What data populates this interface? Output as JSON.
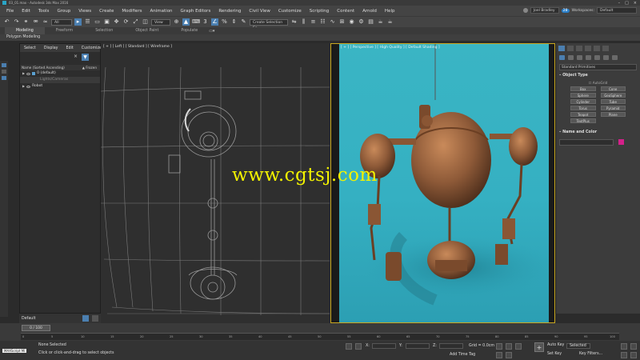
{
  "titlebar": {
    "title": "03_01.max - Autodesk 3ds Max 2016"
  },
  "menus": [
    "File",
    "Edit",
    "Tools",
    "Group",
    "Views",
    "Create",
    "Modifiers",
    "Animation",
    "Graph Editors",
    "Rendering",
    "Civil View",
    "Customize",
    "Scripting",
    "Content",
    "Arnold",
    "Help"
  ],
  "user": {
    "name": "Joel Bradley",
    "badge": "28"
  },
  "workspace": {
    "label": "Workspaces:",
    "value": "Default"
  },
  "toolbar": {
    "filter": "All",
    "view": "View",
    "selection_set": "Create Selection Se"
  },
  "ribbon": {
    "tabs": [
      "Modeling",
      "Freeform",
      "Selection",
      "Object Paint",
      "Populate"
    ],
    "subtitle": "Polygon Modeling"
  },
  "scene_explorer": {
    "menu": [
      "Select",
      "Display",
      "Edit",
      "Customize"
    ],
    "header": {
      "name": "Name (Sorted Ascending)",
      "frozen": "Frozen"
    },
    "rows": [
      {
        "label": "0 (default)"
      },
      {
        "label": "Lights/Cameras"
      },
      {
        "label": "Robot"
      }
    ],
    "bottom_label": "Default"
  },
  "viewport_left": {
    "label": "[ + ] [ Left ] [ Standard ] [ Wireframe ]"
  },
  "viewport_right": {
    "label": "[ + ] [ Perspective ] [ High Quality ] [ Default Shading ]"
  },
  "watermark": "www.cgtsj.com",
  "command_panel": {
    "dropdown": "Standard Primitives",
    "object_type": "Object Type",
    "autogrid": "AutoGrid",
    "buttons": [
      "Box",
      "Cone",
      "Sphere",
      "GeoSphere",
      "Cylinder",
      "Tube",
      "Torus",
      "Pyramid",
      "Teapot",
      "Plane",
      "TextPlus"
    ],
    "name_color": "Name and Color"
  },
  "timeline": {
    "frame": "0 / 100",
    "ticks": [
      "0",
      "5",
      "10",
      "15",
      "20",
      "25",
      "30",
      "35",
      "40",
      "45",
      "50",
      "55",
      "60",
      "65",
      "70",
      "75",
      "80",
      "85",
      "90",
      "95",
      "100"
    ]
  },
  "status": {
    "maxscript": "MAXScript Mi",
    "selected": "None Selected",
    "prompt": "Click or click-and-drag to select objects",
    "x": "X:",
    "y": "Y:",
    "z": "Z:",
    "grid": "Grid = 0.0cm",
    "add_time_tag": "Add Time Tag",
    "auto_key": "Auto Key",
    "set_key": "Set Key",
    "key_mode": "Selected",
    "key_filters": "Key Filters..."
  },
  "colors": {
    "accent": "#4b7fb0",
    "viewport_bg": "#37b2c3",
    "active_border": "#c9a820",
    "watermark": "#f2f200",
    "swatch": "#d4208a"
  }
}
